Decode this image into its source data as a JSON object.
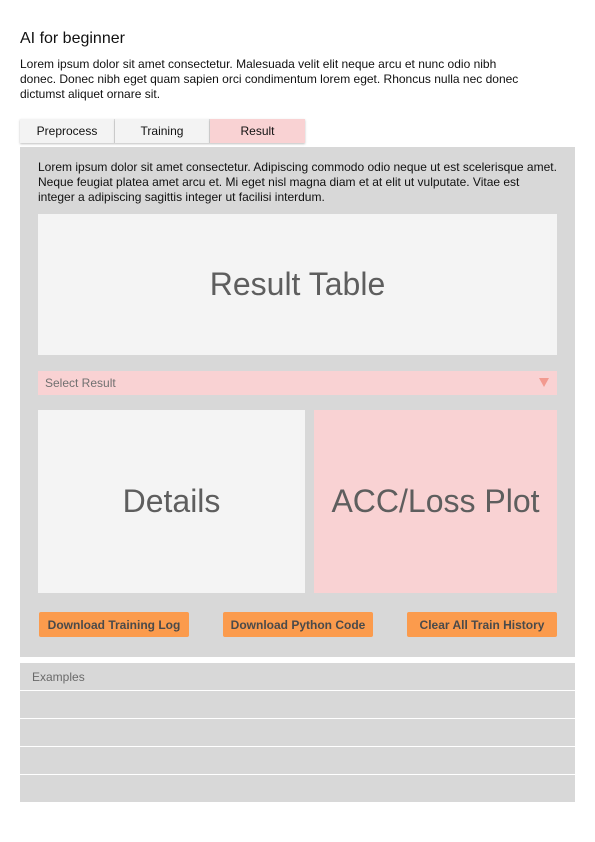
{
  "page": {
    "title": "AI for beginner",
    "intro": "Lorem ipsum dolor sit amet consectetur. Malesuada velit elit neque arcu et nunc odio nibh donec. Donec nibh eget quam sapien orci condimentum lorem eget. Rhoncus nulla nec donec dictumst aliquet ornare sit."
  },
  "tabs": [
    {
      "label": "Preprocess",
      "active": false
    },
    {
      "label": "Training",
      "active": false
    },
    {
      "label": "Result",
      "active": true
    }
  ],
  "result_panel": {
    "description": "Lorem ipsum dolor sit amet consectetur. Adipiscing commodo odio neque ut est scelerisque amet. Neque feugiat platea amet arcu et. Mi eget nisl magna diam et at elit ut vulputate. Vitae est integer a adipiscing sagittis integer ut facilisi interdum.",
    "result_table_label": "Result Table",
    "select_placeholder": "Select Result",
    "details_label": "Details",
    "plot_label": "ACC/Loss Plot",
    "buttons": {
      "download_log": "Download Training Log",
      "download_code": "Download Python Code",
      "clear_history": "Clear All Train History"
    }
  },
  "examples": {
    "header": "Examples",
    "rows": [
      "",
      "",
      "",
      ""
    ]
  },
  "colors": {
    "accent_pink": "#f9d2d3",
    "button_orange": "#fb9b4d",
    "panel_gray": "#d8d8d8"
  }
}
